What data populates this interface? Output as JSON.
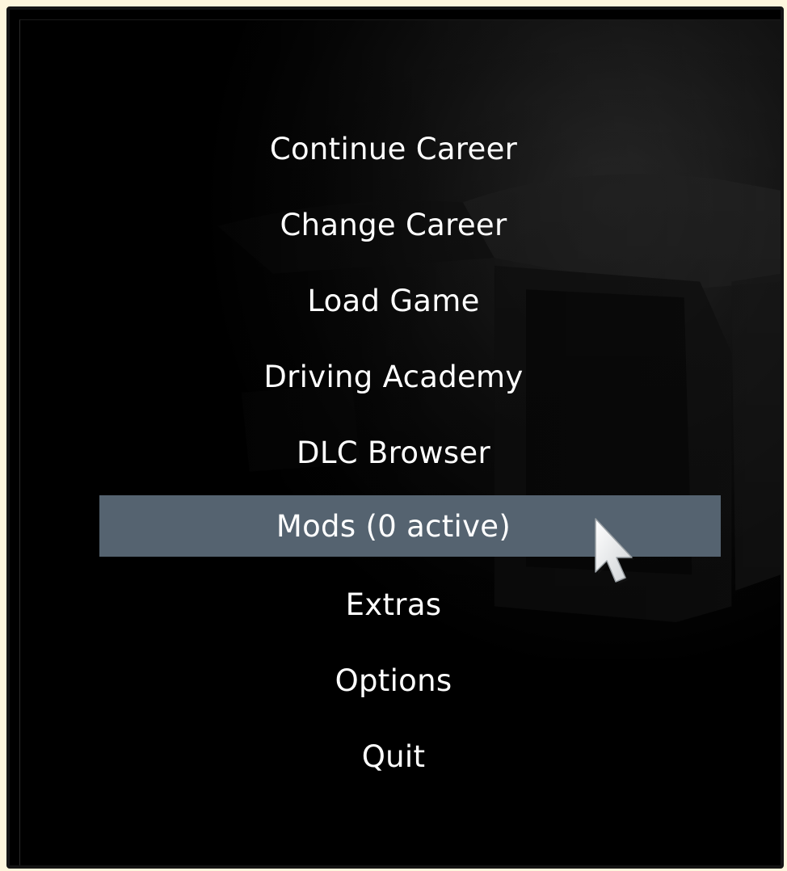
{
  "menu": {
    "items": [
      {
        "label": "Continue Career",
        "selected": false
      },
      {
        "label": "Change Career",
        "selected": false
      },
      {
        "label": "Load Game",
        "selected": false
      },
      {
        "label": "Driving Academy",
        "selected": false
      },
      {
        "label": "DLC Browser",
        "selected": false
      },
      {
        "label": "Mods (0 active)",
        "selected": true
      },
      {
        "label": "Extras",
        "selected": false
      },
      {
        "label": "Options",
        "selected": false
      },
      {
        "label": "Quit",
        "selected": false
      }
    ],
    "highlight_color": "#556370"
  },
  "cursor": {
    "icon": "mouse-pointer-icon"
  },
  "colors": {
    "background": "#000000",
    "text": "#ffffff",
    "outer_border": "#fdf6dd"
  }
}
